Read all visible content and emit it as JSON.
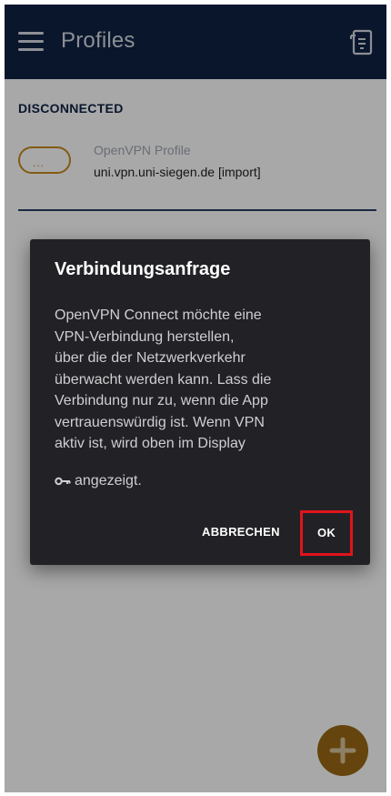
{
  "app_bar": {
    "title": "Profiles",
    "menu_icon": "menu-icon",
    "action_icon": "import-profile-icon",
    "background": "#0f2244"
  },
  "profiles_section": {
    "status_label": "DISCONNECTED",
    "profiles": [
      {
        "name": "OpenVPN Profile",
        "host": "uni.vpn.uni-siegen.de [import]",
        "connected": false,
        "toggle_indicator": "...",
        "accent": "#c78a1e"
      }
    ]
  },
  "dialog": {
    "title": "Verbindungsanfrage",
    "body_lines": [
      "OpenVPN Connect möchte eine",
      "VPN-Verbindung herstellen,",
      "über die der Netzwerkverkehr",
      "überwacht werden kann. Lass die",
      "Verbindung nur zu, wenn die App",
      "vertrauenswürdig ist. Wenn VPN",
      "aktiv ist, wird oben im Display"
    ],
    "note_icon": "vpn-key-icon",
    "note_text": "angezeigt.",
    "cancel_label": "ABBRECHEN",
    "ok_label": "OK",
    "highlight_color": "#e0141c"
  },
  "fab": {
    "icon": "plus-icon",
    "color": "#9a6a14"
  }
}
